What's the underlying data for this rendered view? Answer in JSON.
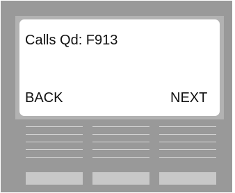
{
  "display": {
    "title": "Calls Qd: F913",
    "softkeys": [
      {
        "label": "BACK"
      },
      {
        "label": "NEXT"
      }
    ]
  },
  "keypad": {
    "columns": 3,
    "lines_per_column": 5,
    "buttons": 3
  },
  "colors": {
    "body": "#999999",
    "bezel": "#b2b2b2",
    "screen": "#ffffff",
    "key_lines": "#d9d9d9",
    "buttons": "#c8c8c8"
  }
}
